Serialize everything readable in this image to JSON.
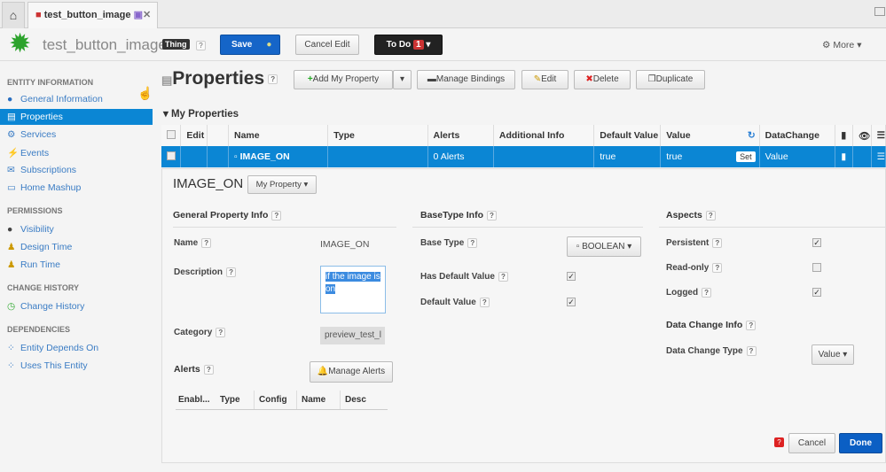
{
  "tabs": {
    "home_icon": "home-icon",
    "entity_tab": "test_button_image"
  },
  "header": {
    "title": "test_button_image",
    "badge": "Thing",
    "save": "Save",
    "cancel_edit": "Cancel Edit",
    "todo": "To Do",
    "todo_count": "1",
    "more": "More"
  },
  "sidebar": {
    "sections": [
      {
        "title": "ENTITY INFORMATION",
        "items": [
          {
            "label": "General Information"
          },
          {
            "label": "Properties"
          },
          {
            "label": "Services"
          },
          {
            "label": "Events"
          },
          {
            "label": "Subscriptions"
          },
          {
            "label": "Home Mashup"
          }
        ]
      },
      {
        "title": "PERMISSIONS",
        "items": [
          {
            "label": "Visibility"
          },
          {
            "label": "Design Time"
          },
          {
            "label": "Run Time"
          }
        ]
      },
      {
        "title": "CHANGE HISTORY",
        "items": [
          {
            "label": "Change History"
          }
        ]
      },
      {
        "title": "DEPENDENCIES",
        "items": [
          {
            "label": "Entity Depends On"
          },
          {
            "label": "Uses This Entity"
          }
        ]
      }
    ]
  },
  "main": {
    "title": "Properties",
    "add": "Add My Property",
    "bindings": "Manage Bindings",
    "edit": "Edit",
    "delete": "Delete",
    "duplicate": "Duplicate",
    "section": "My Properties"
  },
  "grid": {
    "headers": [
      "Edit",
      "Name",
      "Type",
      "Alerts",
      "Additional Info",
      "Default Value",
      "Value",
      "DataChange"
    ],
    "row": {
      "name": "IMAGE_ON",
      "type": "",
      "alerts": "0 Alerts",
      "info": "",
      "default": "true",
      "value": "true",
      "set": "Set",
      "datachange": "Value"
    }
  },
  "detail": {
    "name": "IMAGE_ON",
    "category_type": "My Property",
    "general": {
      "title": "General Property Info",
      "name_label": "Name",
      "name_value": "IMAGE_ON",
      "desc_label": "Description",
      "desc_value": "if the image is on",
      "category_label": "Category",
      "category_value": "preview_test_l"
    },
    "alerts": {
      "title": "Alerts",
      "manage": "Manage Alerts",
      "cols": [
        "Enabl...",
        "Type",
        "Config",
        "Name",
        "Desc"
      ]
    },
    "basetype": {
      "title": "BaseType Info",
      "base_label": "Base Type",
      "base_value": "BOOLEAN",
      "has_default_label": "Has Default Value",
      "has_default": true,
      "default_label": "Default Value",
      "default": true
    },
    "aspects": {
      "title": "Aspects",
      "persistent_label": "Persistent",
      "persistent": true,
      "readonly_label": "Read-only",
      "readonly": false,
      "logged_label": "Logged",
      "logged": true
    },
    "datachange": {
      "title": "Data Change Info",
      "type_label": "Data Change Type",
      "type_value": "Value"
    },
    "cancel": "Cancel",
    "done": "Done"
  },
  "colors": {
    "accent": "#0b86d4",
    "save": "#1565c8",
    "todo": "#222222",
    "done": "#0b5fc4"
  }
}
